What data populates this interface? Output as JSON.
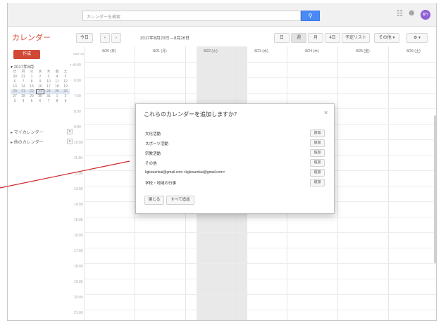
{
  "topbar": {
    "search_placeholder": "カレンダーを検索",
    "search_icon": "search-icon",
    "apps_icon": "apps-grid-icon",
    "notifications_icon": "notifications-icon",
    "avatar_text": "新Y"
  },
  "header": {
    "app_title": "カレンダー",
    "today_label": "今日",
    "prev_label": "‹",
    "next_label": "›",
    "date_range": "2017年8月20日 – 8月26日",
    "views": [
      "日",
      "週",
      "月",
      "4日",
      "予定リスト"
    ],
    "more_label": "その他 ▾",
    "settings_label": "⚙ ▾"
  },
  "sidebar": {
    "create_label": "作成",
    "mini_cal_title": "▾ 2017年8月",
    "mini_cal_nav": "‹ ›",
    "weekday_labels": [
      "日",
      "月",
      "火",
      "水",
      "木",
      "金",
      "土"
    ],
    "weeks": [
      [
        "30",
        "31",
        "1",
        "2",
        "3",
        "4",
        "5"
      ],
      [
        "6",
        "7",
        "8",
        "9",
        "10",
        "11",
        "12"
      ],
      [
        "13",
        "14",
        "15",
        "16",
        "17",
        "18",
        "19"
      ],
      [
        "20",
        "21",
        "22",
        "23",
        "24",
        "25",
        "26"
      ],
      [
        "27",
        "28",
        "29",
        "30",
        "31",
        "1",
        "2"
      ],
      [
        "3",
        "4",
        "5",
        "6",
        "7",
        "8",
        "9"
      ]
    ],
    "my_calendars": "▸ マイカレンダー",
    "other_calendars": "▸ 他のカレンダー"
  },
  "grid": {
    "gmt_label": "GMT+09",
    "day_headers": [
      "8/20 (日)",
      "8/21 (月)",
      "8/22 (火)",
      "8/23 (水)",
      "8/24 (木)",
      "8/25 (金)",
      "8/26 (土)"
    ],
    "hours": [
      "5:00",
      "6:00",
      "7:00",
      "8:00",
      "9:00",
      "10:00",
      "11:00",
      "12:00",
      "13:00",
      "14:00",
      "15:00",
      "16:00",
      "17:00",
      "18:00",
      "19:00",
      "20:00",
      "21:00"
    ]
  },
  "dialog": {
    "title": "これらのカレンダーを追加しますか？",
    "close_icon": "close-icon",
    "calendars": [
      "文化活動",
      "スポーツ活動",
      "宗教活動",
      "その他",
      "kgkouenkai@gmail.com <kgkouenkai@gmail.com>",
      "学校・地域の行事"
    ],
    "add_label": "追加",
    "close_label": "閉じる",
    "add_all_label": "すべて追加"
  },
  "colors": {
    "accent_red": "#dd4b39",
    "create_button": "#d14836",
    "search_button": "#4a8af4",
    "avatar": "#8e5fd6",
    "annotation_line": "#d0262b"
  }
}
